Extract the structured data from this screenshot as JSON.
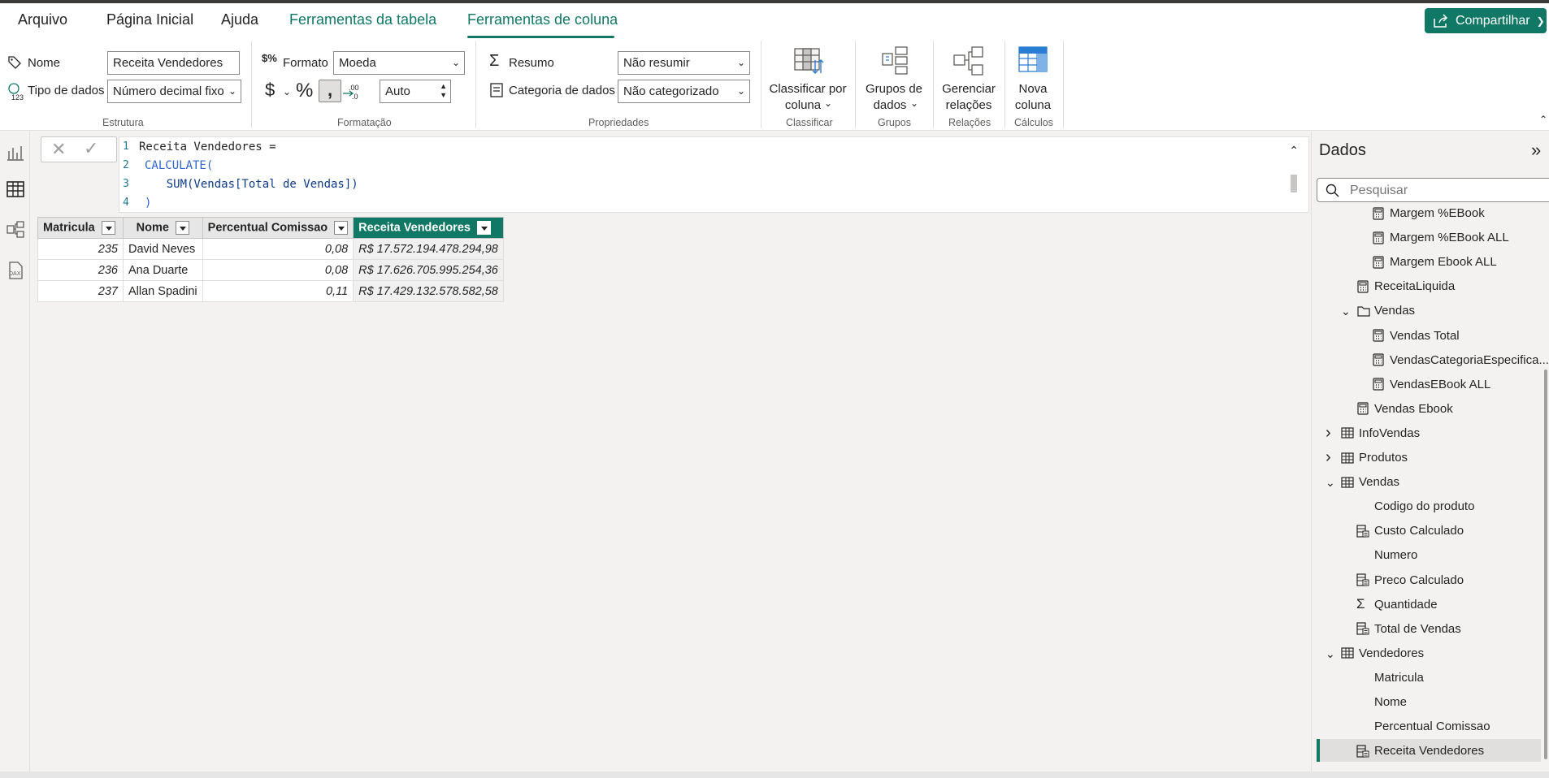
{
  "menu": {
    "tabs": [
      "Arquivo",
      "Página Inicial",
      "Ajuda",
      "Ferramentas da tabela",
      "Ferramentas de coluna"
    ],
    "share_label": "Compartilhar"
  },
  "ribbon": {
    "estrutura": {
      "name_label": "Nome",
      "name_value": "Receita Vendedores",
      "type_label": "Tipo de dados",
      "type_value": "Número decimal fixo",
      "group_title": "Estrutura"
    },
    "formatacao": {
      "format_label": "Formato",
      "format_value": "Moeda",
      "currency_symbol": "$",
      "percent_symbol": "%",
      "comma_symbol": "։",
      "decimals_value": "Auto",
      "group_title": "Formatação"
    },
    "propriedades": {
      "summary_label": "Resumo",
      "summary_value": "Não resumir",
      "category_label": "Categoria de dados",
      "category_value": "Não categorizado",
      "group_title": "Propriedades"
    },
    "classificar": {
      "btn_line1": "Classificar por",
      "btn_line2": "coluna",
      "group_title": "Classificar"
    },
    "grupos": {
      "btn_line1": "Grupos de",
      "btn_line2": "dados",
      "group_title": "Grupos"
    },
    "relacoes": {
      "btn_line1": "Gerenciar",
      "btn_line2": "relações",
      "group_title": "Relações"
    },
    "calculos": {
      "btn_line1": "Nova",
      "btn_line2": "coluna",
      "group_title": "Cálculos"
    }
  },
  "formula": {
    "lines": [
      {
        "num": "1",
        "text": "Receita Vendedores ="
      },
      {
        "num": "2",
        "text": "CALCULATE("
      },
      {
        "num": "3",
        "text": "    SUM(Vendas[Total de Vendas])"
      },
      {
        "num": "4",
        "text": ")"
      }
    ]
  },
  "table": {
    "headers": [
      "Matricula",
      "Nome",
      "Percentual Comissao",
      "Receita Vendedores"
    ],
    "rows": [
      [
        "235",
        "David Neves",
        "0,08",
        "R$ 17.572.194.478.294,98"
      ],
      [
        "236",
        "Ana Duarte",
        "0,08",
        "R$ 17.626.705.995.254,36"
      ],
      [
        "237",
        "Allan Spadini",
        "0,11",
        "R$ 17.429.132.578.582,58"
      ]
    ]
  },
  "data_pane": {
    "title": "Dados",
    "search_placeholder": "Pesquisar",
    "items": [
      {
        "label": "Margem %EBook",
        "icon": "calculator-icon"
      },
      {
        "label": "Margem %EBook ALL",
        "icon": "calculator-icon"
      },
      {
        "label": "Margem Ebook ALL",
        "icon": "calculator-icon"
      },
      {
        "label": "ReceitaLiquida",
        "icon": "calculator-icon"
      },
      {
        "label": "Vendas",
        "icon": "folder-icon"
      },
      {
        "label": "Vendas Total",
        "icon": "calculator-icon"
      },
      {
        "label": "VendasCategoriaEspecifica...",
        "icon": "calculator-icon"
      },
      {
        "label": "VendasEBook ALL",
        "icon": "calculator-icon"
      },
      {
        "label": "Vendas Ebook",
        "icon": "calculator-icon"
      },
      {
        "label": "InfoVendas",
        "icon": "table-icon"
      },
      {
        "label": "Produtos",
        "icon": "table-icon"
      },
      {
        "label": "Vendas",
        "icon": "table-icon"
      },
      {
        "label": "Codigo do produto",
        "icon": "none"
      },
      {
        "label": "Custo Calculado",
        "icon": "calc-column-icon"
      },
      {
        "label": "Numero",
        "icon": "none"
      },
      {
        "label": "Preco Calculado",
        "icon": "calc-column-icon"
      },
      {
        "label": "Quantidade",
        "icon": "sigma-icon"
      },
      {
        "label": "Total de Vendas",
        "icon": "calc-column-icon"
      },
      {
        "label": "Vendedores",
        "icon": "table-icon"
      },
      {
        "label": "Matricula",
        "icon": "none"
      },
      {
        "label": "Nome",
        "icon": "none"
      },
      {
        "label": "Percentual Comissao",
        "icon": "none"
      },
      {
        "label": "Receita Vendedores",
        "icon": "calc-column-icon"
      }
    ]
  },
  "colors": {
    "accent": "#117865",
    "header_bg": "#e6e6e6"
  }
}
